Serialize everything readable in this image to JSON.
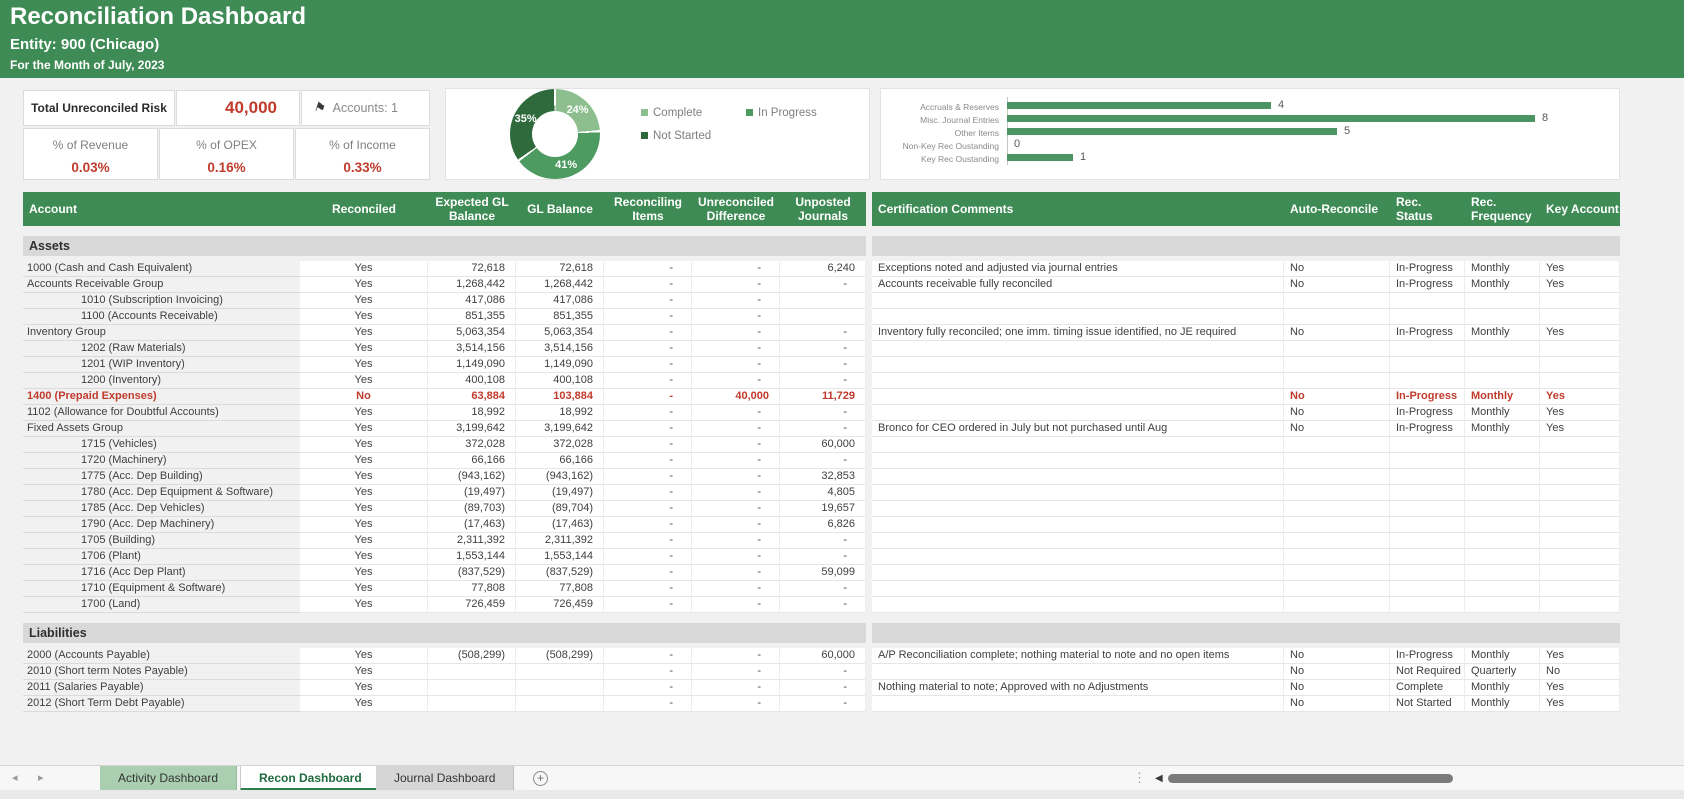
{
  "header": {
    "title": "Reconciliation Dashboard",
    "entity": "Entity: 900 (Chicago)",
    "period": "For the Month of July, 2023"
  },
  "kpis": {
    "risk_label": "Total Unreconciled Risk",
    "risk_value": "40,000",
    "accounts_label": "Accounts: 1",
    "metrics": [
      {
        "label": "% of Revenue",
        "value": "0.03%"
      },
      {
        "label": "% of OPEX",
        "value": "0.16%"
      },
      {
        "label": "% of Income",
        "value": "0.33%"
      }
    ]
  },
  "colors": {
    "banner_green": "#3F8B55",
    "accent_red": "#C03B2C",
    "bar_green": "#4A9562",
    "donut_complete": "#8CBE8E",
    "donut_in_progress": "#4E9B62",
    "donut_not_started": "#2E6A3B"
  },
  "chart_data": [
    {
      "type": "pie",
      "donut": true,
      "labels": [
        "Complete",
        "In Progress",
        "Not Started"
      ],
      "values": [
        24,
        41,
        35
      ],
      "unit": "%",
      "colors": [
        "#8CBE8E",
        "#4E9B62",
        "#2E6A3B"
      ],
      "legend_position": "right",
      "data_labels": [
        "24%",
        "41%",
        "35%"
      ]
    },
    {
      "type": "bar",
      "orientation": "horizontal",
      "categories": [
        "Accruals & Reserves",
        "Misc. Journal Entries",
        "Other Items",
        "Non-Key Rec Oustanding",
        "Key Rec Oustanding"
      ],
      "values": [
        4,
        8,
        5,
        0,
        1
      ],
      "xlim": [
        0,
        8
      ],
      "grid": false,
      "data_labels": true
    }
  ],
  "table": {
    "columns": [
      "Account",
      "Reconciled",
      "Expected GL Balance",
      "GL Balance",
      "Reconciling Items",
      "Unreconciled Difference",
      "Unposted Journals",
      "Certification Comments",
      "Auto-Reconcile",
      "Rec. Status",
      "Rec. Frequency",
      "Key Account"
    ],
    "sections": [
      {
        "name": "Assets",
        "rows": [
          {
            "account": "1000 (Cash and Cash Equivalent)",
            "indent": false,
            "reconciled": "Yes",
            "expected": "72,618",
            "gl": "72,618",
            "rec_items": "-",
            "unrec_diff": "-",
            "unposted": "6,240",
            "comment": "Exceptions noted and adjusted via journal entries",
            "auto": "No",
            "status": "In-Progress",
            "freq": "Monthly",
            "key": "Yes",
            "alert": false
          },
          {
            "account": "Accounts Receivable Group",
            "indent": false,
            "reconciled": "Yes",
            "expected": "1,268,442",
            "gl": "1,268,442",
            "rec_items": "-",
            "unrec_diff": "-",
            "unposted": "-",
            "comment": "Accounts receivable fully reconciled",
            "auto": "No",
            "status": "In-Progress",
            "freq": "Monthly",
            "key": "Yes",
            "alert": false
          },
          {
            "account": "1010 (Subscription Invoicing)",
            "indent": true,
            "reconciled": "Yes",
            "expected": "417,086",
            "gl": "417,086",
            "rec_items": "-",
            "unrec_diff": "-",
            "unposted": "",
            "comment": "",
            "auto": "",
            "status": "",
            "freq": "",
            "key": "",
            "alert": false
          },
          {
            "account": "1100 (Accounts Receivable)",
            "indent": true,
            "reconciled": "Yes",
            "expected": "851,355",
            "gl": "851,355",
            "rec_items": "-",
            "unrec_diff": "-",
            "unposted": "",
            "comment": "",
            "auto": "",
            "status": "",
            "freq": "",
            "key": "",
            "alert": false
          },
          {
            "account": "Inventory Group",
            "indent": false,
            "reconciled": "Yes",
            "expected": "5,063,354",
            "gl": "5,063,354",
            "rec_items": "-",
            "unrec_diff": "-",
            "unposted": "-",
            "comment": "Inventory fully reconciled; one imm. timing issue identified, no JE required",
            "auto": "No",
            "status": "In-Progress",
            "freq": "Monthly",
            "key": "Yes",
            "alert": false
          },
          {
            "account": "1202 (Raw Materials)",
            "indent": true,
            "reconciled": "Yes",
            "expected": "3,514,156",
            "gl": "3,514,156",
            "rec_items": "-",
            "unrec_diff": "-",
            "unposted": "-",
            "comment": "",
            "auto": "",
            "status": "",
            "freq": "",
            "key": "",
            "alert": false
          },
          {
            "account": "1201 (WIP Inventory)",
            "indent": true,
            "reconciled": "Yes",
            "expected": "1,149,090",
            "gl": "1,149,090",
            "rec_items": "-",
            "unrec_diff": "-",
            "unposted": "-",
            "comment": "",
            "auto": "",
            "status": "",
            "freq": "",
            "key": "",
            "alert": false
          },
          {
            "account": "1200 (Inventory)",
            "indent": true,
            "reconciled": "Yes",
            "expected": "400,108",
            "gl": "400,108",
            "rec_items": "-",
            "unrec_diff": "-",
            "unposted": "-",
            "comment": "",
            "auto": "",
            "status": "",
            "freq": "",
            "key": "",
            "alert": false
          },
          {
            "account": "1400 (Prepaid Expenses)",
            "indent": false,
            "reconciled": "No",
            "expected": "63,884",
            "gl": "103,884",
            "rec_items": "-",
            "unrec_diff": "40,000",
            "unposted": "11,729",
            "comment": "",
            "auto": "No",
            "status": "In-Progress",
            "freq": "Monthly",
            "key": "Yes",
            "alert": true
          },
          {
            "account": "1102 (Allowance for Doubtful Accounts)",
            "indent": false,
            "reconciled": "Yes",
            "expected": "18,992",
            "gl": "18,992",
            "rec_items": "-",
            "unrec_diff": "-",
            "unposted": "-",
            "comment": "",
            "auto": "No",
            "status": "In-Progress",
            "freq": "Monthly",
            "key": "Yes",
            "alert": false
          },
          {
            "account": "Fixed Assets Group",
            "indent": false,
            "reconciled": "Yes",
            "expected": "3,199,642",
            "gl": "3,199,642",
            "rec_items": "-",
            "unrec_diff": "-",
            "unposted": "-",
            "comment": "Bronco for CEO ordered in July but not purchased until Aug",
            "auto": "No",
            "status": "In-Progress",
            "freq": "Monthly",
            "key": "Yes",
            "alert": false
          },
          {
            "account": "1715 (Vehicles)",
            "indent": true,
            "reconciled": "Yes",
            "expected": "372,028",
            "gl": "372,028",
            "rec_items": "-",
            "unrec_diff": "-",
            "unposted": "60,000",
            "comment": "",
            "auto": "",
            "status": "",
            "freq": "",
            "key": "",
            "alert": false
          },
          {
            "account": "1720 (Machinery)",
            "indent": true,
            "reconciled": "Yes",
            "expected": "66,166",
            "gl": "66,166",
            "rec_items": "-",
            "unrec_diff": "-",
            "unposted": "-",
            "comment": "",
            "auto": "",
            "status": "",
            "freq": "",
            "key": "",
            "alert": false
          },
          {
            "account": "1775 (Acc. Dep Building)",
            "indent": true,
            "reconciled": "Yes",
            "expected": "(943,162)",
            "gl": "(943,162)",
            "rec_items": "-",
            "unrec_diff": "-",
            "unposted": "32,853",
            "comment": "",
            "auto": "",
            "status": "",
            "freq": "",
            "key": "",
            "alert": false
          },
          {
            "account": "1780 (Acc. Dep Equipment & Software)",
            "indent": true,
            "reconciled": "Yes",
            "expected": "(19,497)",
            "gl": "(19,497)",
            "rec_items": "-",
            "unrec_diff": "-",
            "unposted": "4,805",
            "comment": "",
            "auto": "",
            "status": "",
            "freq": "",
            "key": "",
            "alert": false
          },
          {
            "account": "1785 (Acc. Dep Vehicles)",
            "indent": true,
            "reconciled": "Yes",
            "expected": "(89,703)",
            "gl": "(89,704)",
            "rec_items": "-",
            "unrec_diff": "-",
            "unposted": "19,657",
            "comment": "",
            "auto": "",
            "status": "",
            "freq": "",
            "key": "",
            "alert": false
          },
          {
            "account": "1790 (Acc. Dep Machinery)",
            "indent": true,
            "reconciled": "Yes",
            "expected": "(17,463)",
            "gl": "(17,463)",
            "rec_items": "-",
            "unrec_diff": "-",
            "unposted": "6,826",
            "comment": "",
            "auto": "",
            "status": "",
            "freq": "",
            "key": "",
            "alert": false
          },
          {
            "account": "1705 (Building)",
            "indent": true,
            "reconciled": "Yes",
            "expected": "2,311,392",
            "gl": "2,311,392",
            "rec_items": "-",
            "unrec_diff": "-",
            "unposted": "-",
            "comment": "",
            "auto": "",
            "status": "",
            "freq": "",
            "key": "",
            "alert": false
          },
          {
            "account": "1706 (Plant)",
            "indent": true,
            "reconciled": "Yes",
            "expected": "1,553,144",
            "gl": "1,553,144",
            "rec_items": "-",
            "unrec_diff": "-",
            "unposted": "-",
            "comment": "",
            "auto": "",
            "status": "",
            "freq": "",
            "key": "",
            "alert": false
          },
          {
            "account": "1716 (Acc Dep Plant)",
            "indent": true,
            "reconciled": "Yes",
            "expected": "(837,529)",
            "gl": "(837,529)",
            "rec_items": "-",
            "unrec_diff": "-",
            "unposted": "59,099",
            "comment": "",
            "auto": "",
            "status": "",
            "freq": "",
            "key": "",
            "alert": false
          },
          {
            "account": "1710 (Equipment & Software)",
            "indent": true,
            "reconciled": "Yes",
            "expected": "77,808",
            "gl": "77,808",
            "rec_items": "-",
            "unrec_diff": "-",
            "unposted": "-",
            "comment": "",
            "auto": "",
            "status": "",
            "freq": "",
            "key": "",
            "alert": false
          },
          {
            "account": "1700 (Land)",
            "indent": true,
            "reconciled": "Yes",
            "expected": "726,459",
            "gl": "726,459",
            "rec_items": "-",
            "unrec_diff": "-",
            "unposted": "-",
            "comment": "",
            "auto": "",
            "status": "",
            "freq": "",
            "key": "",
            "alert": false
          }
        ]
      },
      {
        "name": "Liabilities",
        "rows": [
          {
            "account": "2000 (Accounts Payable)",
            "indent": false,
            "reconciled": "Yes",
            "expected": "(508,299)",
            "gl": "(508,299)",
            "rec_items": "-",
            "unrec_diff": "-",
            "unposted": "60,000",
            "comment": "A/P Reconciliation complete; nothing material to note and no open items",
            "auto": "No",
            "status": "In-Progress",
            "freq": "Monthly",
            "key": "Yes",
            "alert": false
          },
          {
            "account": "2010 (Short term Notes Payable)",
            "indent": false,
            "reconciled": "Yes",
            "expected": "",
            "gl": "",
            "rec_items": "-",
            "unrec_diff": "-",
            "unposted": "-",
            "comment": "",
            "auto": "No",
            "status": "Not Required",
            "freq": "Quarterly",
            "key": "No",
            "alert": false
          },
          {
            "account": "2011 (Salaries Payable)",
            "indent": false,
            "reconciled": "Yes",
            "expected": "",
            "gl": "",
            "rec_items": "-",
            "unrec_diff": "-",
            "unposted": "-",
            "comment": "Nothing material to note; Approved with no Adjustments",
            "auto": "No",
            "status": "Complete",
            "freq": "Monthly",
            "key": "Yes",
            "alert": false
          },
          {
            "account": "2012 (Short Term Debt Payable)",
            "indent": false,
            "reconciled": "Yes",
            "expected": "",
            "gl": "",
            "rec_items": "-",
            "unrec_diff": "-",
            "unposted": "-",
            "comment": "",
            "auto": "No",
            "status": "Not Started",
            "freq": "Monthly",
            "key": "Yes",
            "alert": false
          }
        ]
      }
    ]
  },
  "sheet_tabs": {
    "tabs": [
      {
        "label": "Activity Dashboard",
        "active": false
      },
      {
        "label": "Recon Dashboard",
        "active": true
      },
      {
        "label": "Journal Dashboard",
        "active": false
      }
    ]
  }
}
